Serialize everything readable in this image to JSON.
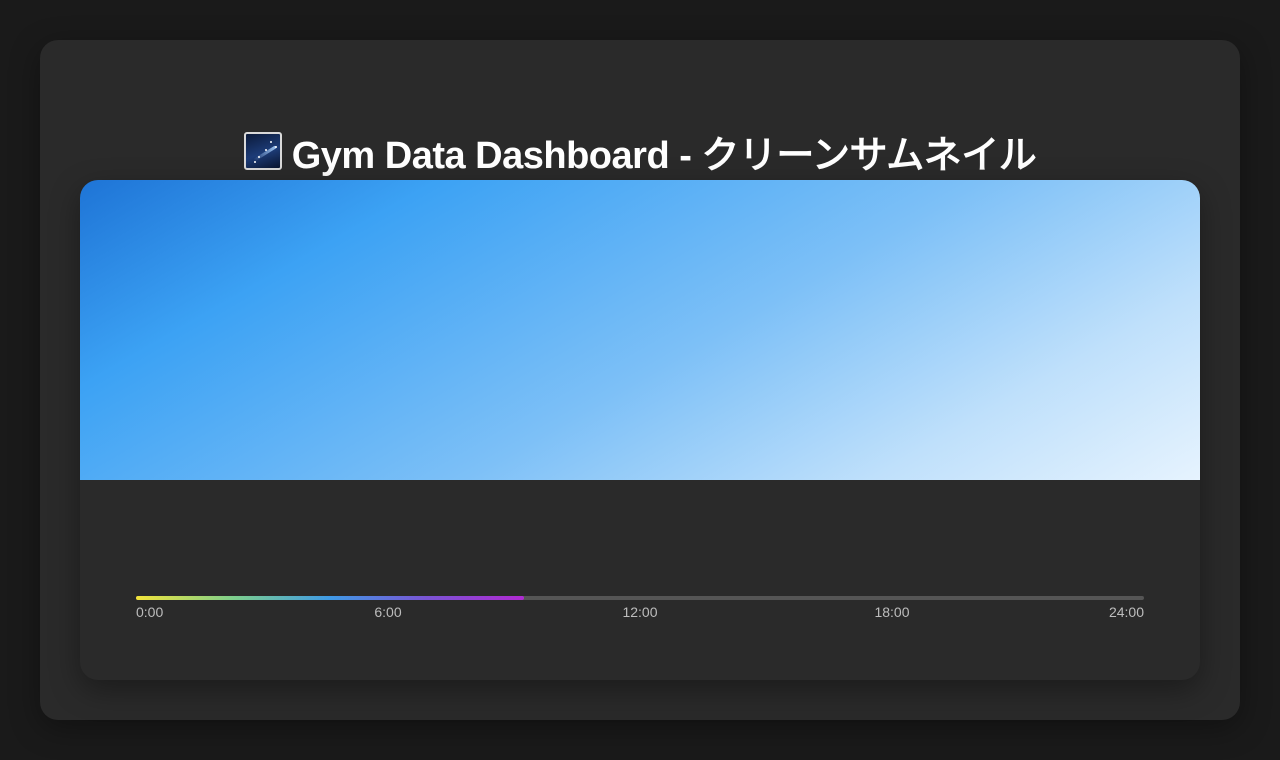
{
  "header": {
    "icon": "shooting-star-icon",
    "title": "Gym Data Dashboard - クリーンサムネイル"
  },
  "card": {
    "hero_gradient": [
      "#1e74d6",
      "#3ca2f4",
      "#7dc0f7",
      "#bfe0fb",
      "#e6f3fe"
    ],
    "timeline": {
      "progress": 0.385,
      "colors": [
        "#f2e33a",
        "#7ecf8c",
        "#3f9ae6",
        "#7a54d4",
        "#b02ad2"
      ],
      "ticks": [
        "0:00",
        "6:00",
        "12:00",
        "18:00",
        "24:00"
      ]
    }
  }
}
